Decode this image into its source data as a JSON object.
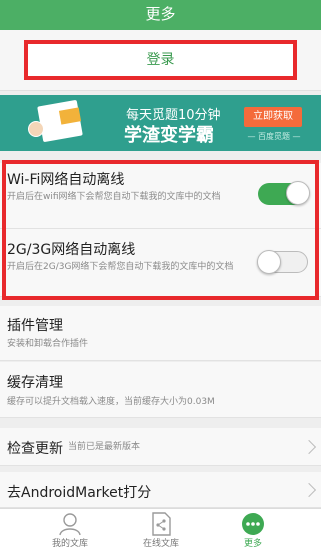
{
  "header": {
    "title": "更多"
  },
  "login": {
    "label": "登录"
  },
  "banner": {
    "line1": "每天觅题10分钟",
    "line2": "学渣变学霸",
    "cta": "立即获取",
    "brand": "— 百度觅题 —"
  },
  "settings": {
    "wifi": {
      "title": "Wi-Fi网络自动离线",
      "desc": "开启后在wifi网络下会帮您自动下载我的文库中的文档",
      "enabled": true
    },
    "cellular": {
      "title": "2G/3G网络自动离线",
      "desc": "开启后在2G/3G网络下会帮您自动下载我的文库中的文档",
      "enabled": false
    }
  },
  "plugins": {
    "title": "插件管理",
    "desc": "安装和卸载合作插件"
  },
  "cache": {
    "title": "缓存清理",
    "desc": "缓存可以提升文档载入速度，当前缓存大小为0.03M"
  },
  "update": {
    "title": "检查更新",
    "status": "当前已是最新版本"
  },
  "rate": {
    "title": "去AndroidMarket打分"
  },
  "tabs": [
    {
      "label": "我的文库",
      "icon": "person-icon"
    },
    {
      "label": "在线文库",
      "icon": "document-share-icon"
    },
    {
      "label": "更多",
      "icon": "more-icon"
    }
  ],
  "colors": {
    "brand_green": "#4caf65",
    "highlight_red": "#e8292c",
    "toggle_on": "#3ea953"
  }
}
